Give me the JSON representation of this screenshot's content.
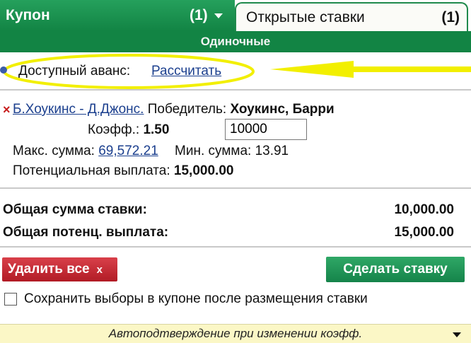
{
  "tabs": {
    "coupon_label": "Купон",
    "coupon_count": "(1)",
    "open_bets_label": "Открытые ставки",
    "open_bets_count": "(1)"
  },
  "section_title": "Одиночные",
  "advance": {
    "label": "Доступный аванс:",
    "action_link": "Рассчитать"
  },
  "selection": {
    "event": "Б.Хоукинс - Д.Джонс.",
    "market": "Победитель:",
    "pick": "Хоукинс, Барри",
    "odds_label": "Коэфф.:",
    "odds_value": "1.50",
    "stake_value": "10000",
    "max_label": "Макс. сумма:",
    "max_value": "69,572.21",
    "min_label": "Мин. сумма:",
    "min_value": "13.91",
    "payout_label": "Потенциальная выплата:",
    "payout_value": "15,000.00"
  },
  "totals": {
    "stake_label": "Общая сумма ставки:",
    "stake_value": "10,000.00",
    "payout_label": "Общая потенц. выплата:",
    "payout_value": "15,000.00"
  },
  "actions": {
    "delete_all": "Удалить все",
    "delete_x": "x",
    "place_bet": "Сделать ставку"
  },
  "keep_selections_label": "Сохранить выборы в купоне после размещения ставки",
  "footer_text": "Автоподтверждение при изменении коэфф.",
  "colors": {
    "brand_green": "#128444",
    "delete_red": "#c41f2a",
    "highlight_yellow": "#f2ef00",
    "link_blue": "#1b3f8e"
  }
}
